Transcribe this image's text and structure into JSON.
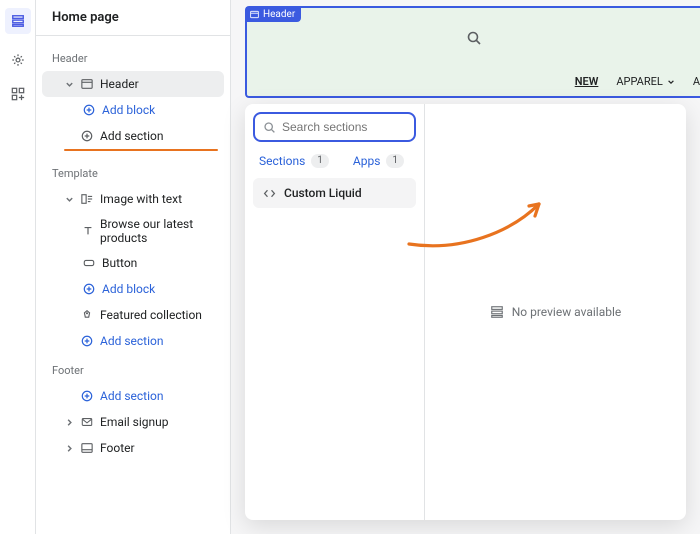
{
  "pageTitle": "Home page",
  "headerGroup": "Header",
  "headerSection": "Header",
  "addBlock": "Add block",
  "addSection": "Add section",
  "templateGroup": "Template",
  "imageWithText": "Image with text",
  "browseProducts": "Browse our latest products",
  "button": "Button",
  "featuredCollection": "Featured collection",
  "footerGroup": "Footer",
  "emailSignup": "Email signup",
  "footerSection": "Footer",
  "previewTag": "Header",
  "navNew": "NEW",
  "navApparel": "APPAREL",
  "navA": "A",
  "searchPlaceholder": "Search sections",
  "tabSections": "Sections",
  "tabSectionsCount": "1",
  "tabApps": "Apps",
  "tabAppsCount": "1",
  "customLiquid": "Custom Liquid",
  "noPreview": "No preview available"
}
